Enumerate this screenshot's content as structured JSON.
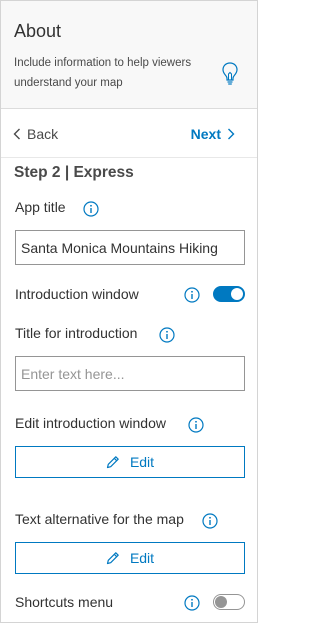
{
  "header": {
    "title": "About",
    "description": "Include information to help viewers understand your map"
  },
  "nav": {
    "back_label": "Back",
    "next_label": "Next"
  },
  "step": {
    "title": "Step 2 | Express"
  },
  "fields": {
    "app_title": {
      "label": "App title",
      "value": "Santa Monica Mountains Hiking"
    },
    "intro_window": {
      "label": "Introduction window",
      "enabled": true
    },
    "intro_title": {
      "label": "Title for introduction",
      "placeholder": "Enter text here..."
    },
    "edit_intro": {
      "label": "Edit introduction window",
      "button_label": "Edit"
    },
    "text_alt": {
      "label": "Text alternative for the map",
      "button_label": "Edit"
    },
    "shortcuts": {
      "label": "Shortcuts menu",
      "enabled": false
    }
  },
  "colors": {
    "accent": "#0079c1",
    "header_bg": "#f8f8f8",
    "text": "#4a4a4a"
  }
}
